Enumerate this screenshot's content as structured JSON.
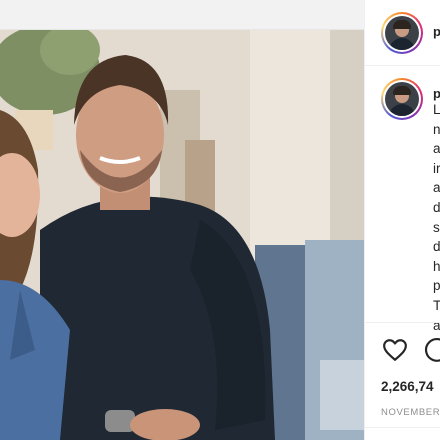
{
  "post": {
    "image_alt": "Photo of a smiling couple seated on a sofa",
    "username": "p",
    "caption_lines": [
      "L",
      "n",
      "a",
      "ir",
      "a",
      "d",
      "s",
      "d",
      "h",
      "p",
      "T",
      "a"
    ],
    "likes": "2,266,74",
    "date": "NOVEMBER"
  },
  "icons": {
    "like": "heart-icon",
    "comment": "comment-icon"
  },
  "colors": {
    "story_ring": [
      "#f58529",
      "#dd2a7b",
      "#8134af",
      "#515bd4"
    ],
    "text": "#262626",
    "secondary_text": "#8e8e8e"
  }
}
